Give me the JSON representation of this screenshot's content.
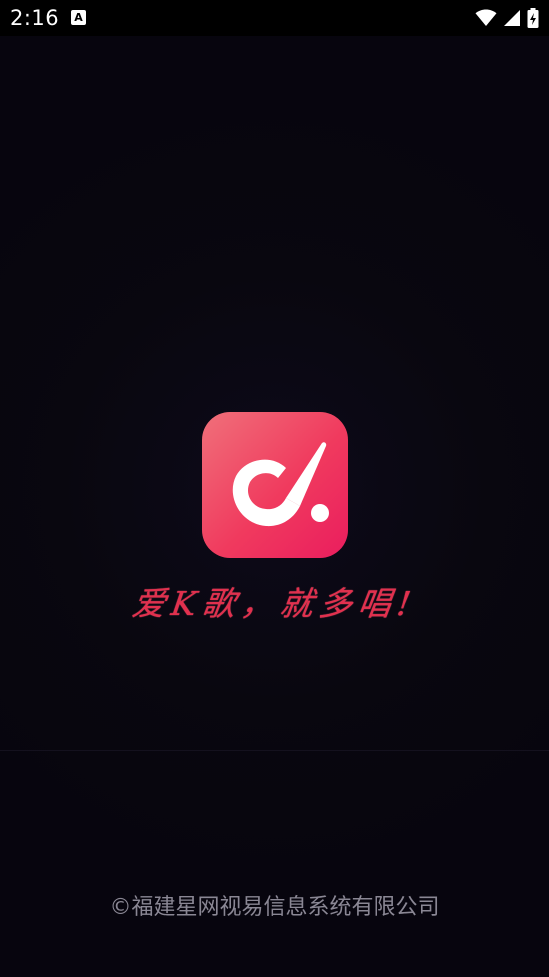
{
  "status_bar": {
    "time": "2:16",
    "notification_glyph": "A",
    "icons": [
      "wifi-icon",
      "cellular-signal-icon",
      "battery-charging-icon"
    ]
  },
  "splash": {
    "logo_icon": "app-logo-icon",
    "slogan": "爱K歌，就多唱!",
    "copyright": "©福建星网视易信息系统有限公司"
  },
  "colors": {
    "background": "#09070f",
    "logo_gradient_start": "#f0606f",
    "logo_gradient_end": "#ee2160",
    "slogan": "#e2304e",
    "copyright": "#8a8794"
  }
}
